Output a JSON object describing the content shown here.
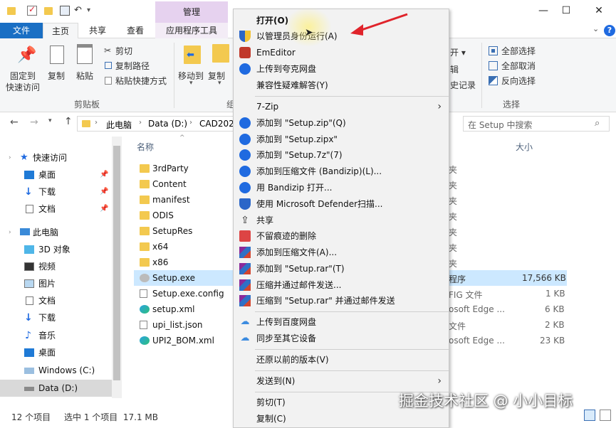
{
  "titlebar": {
    "context_tab_title": "管理",
    "minimize": "—",
    "maximize": "☐",
    "close": "✕"
  },
  "tabs": {
    "file": "文件",
    "home": "主页",
    "share": "共享",
    "view": "查看",
    "app_tools": "应用程序工具"
  },
  "ribbon": {
    "pin_quick_access": "固定到\n快速访问",
    "pin_line1": "固定到",
    "pin_line2": "快速访问",
    "copy": "复制",
    "paste": "粘贴",
    "cut": "剪切",
    "copy_path": "复制路径",
    "paste_shortcut": "粘贴快捷方式",
    "move_to": "移动到",
    "clipboard_group": "剪贴板",
    "open_dropdown": "开 ▾",
    "edit_partial": "辑",
    "history_partial": "史记录",
    "select_all": "全部选择",
    "select_none": "全部取消",
    "invert_selection": "反向选择",
    "select_group": "选择"
  },
  "address": {
    "breadcrumb": [
      "此电脑",
      "Data (D:)",
      "CAD202"
    ],
    "search_placeholder": "在 Setup 中搜索"
  },
  "columns": {
    "name": "名称",
    "size": "大小"
  },
  "nav_pane": [
    {
      "label": "快速访问",
      "icon": "star-icon"
    },
    {
      "label": "桌面",
      "icon": "desktop-icon",
      "pinned": true
    },
    {
      "label": "下载",
      "icon": "download-icon",
      "pinned": true
    },
    {
      "label": "文档",
      "icon": "document-icon",
      "pinned": true
    },
    {
      "label": "此电脑",
      "icon": "computer-icon"
    },
    {
      "label": "3D 对象",
      "icon": "cube-icon"
    },
    {
      "label": "视频",
      "icon": "video-icon"
    },
    {
      "label": "图片",
      "icon": "picture-icon"
    },
    {
      "label": "文档",
      "icon": "document-icon"
    },
    {
      "label": "下载",
      "icon": "download-icon"
    },
    {
      "label": "音乐",
      "icon": "music-icon"
    },
    {
      "label": "桌面",
      "icon": "desktop-icon"
    },
    {
      "label": "Windows (C:)",
      "icon": "drive-icon"
    },
    {
      "label": "Data (D:)",
      "icon": "drive-icon"
    }
  ],
  "files": [
    {
      "name": "3rdParty",
      "type": "folder",
      "type_partial": "夹",
      "size": ""
    },
    {
      "name": "Content",
      "type": "folder",
      "type_partial": "夹",
      "size": ""
    },
    {
      "name": "manifest",
      "type": "folder",
      "type_partial": "夹",
      "size": ""
    },
    {
      "name": "ODIS",
      "type": "folder",
      "type_partial": "夹",
      "size": ""
    },
    {
      "name": "SetupRes",
      "type": "folder",
      "type_partial": "夹",
      "size": ""
    },
    {
      "name": "x64",
      "type": "folder",
      "type_partial": "夹",
      "size": ""
    },
    {
      "name": "x86",
      "type": "folder",
      "type_partial": "夹",
      "size": ""
    },
    {
      "name": "Setup.exe",
      "type": "exe",
      "type_partial": "程序",
      "size": "17,566 KB"
    },
    {
      "name": "Setup.exe.config",
      "type": "file",
      "type_partial": "FIG 文件",
      "size": "1 KB"
    },
    {
      "name": "setup.xml",
      "type": "edge",
      "type_partial": "osoft Edge ...",
      "size": "6 KB"
    },
    {
      "name": "upi_list.json",
      "type": "file",
      "type_partial": "文件",
      "size": "2 KB"
    },
    {
      "name": "UPI2_BOM.xml",
      "type": "edge",
      "type_partial": "osoft Edge ...",
      "size": "23 KB"
    }
  ],
  "context_menu": {
    "open": "打开(O)",
    "run_as_admin": "以管理员身份运行(A)",
    "emeditor": "EmEditor",
    "upload_quark": "上传到夸克网盘",
    "compat": "兼容性疑难解答(Y)",
    "seven_zip": "7-Zip",
    "add_zip": "添加到 \"Setup.zip\"(Q)",
    "add_zipx": "添加到 \"Setup.zipx\"",
    "add_7z": "添加到 \"Setup.7z\"(7)",
    "add_compress_bandizip": "添加到压缩文件 (Bandizip)(L)...",
    "open_bandizip": "用 Bandizip 打开...",
    "defender": "使用 Microsoft Defender扫描...",
    "share": "共享",
    "delete_no_trace": "不留痕迹的删除",
    "add_archive": "添加到压缩文件(A)...",
    "add_rar": "添加到 \"Setup.rar\"(T)",
    "compress_email": "压缩并通过邮件发送...",
    "compress_rar_email": "压缩到 \"Setup.rar\" 并通过邮件发送",
    "upload_baidu": "上传到百度网盘",
    "sync_devices": "同步至其它设备",
    "restore_versions": "还原以前的版本(V)",
    "send_to": "发送到(N)",
    "cut": "剪切(T)",
    "copy": "复制(C)"
  },
  "status": {
    "item_count": "12 个项目",
    "selected": "选中 1 个项目  17.1 MB"
  },
  "watermark": "掘金技术社区 @ 小小目标",
  "colors": {
    "accent": "#1a6fc4",
    "context_tab": "#e6d2ef",
    "selection": "#cce8ff",
    "annotation_arrow": "#e0242b"
  }
}
